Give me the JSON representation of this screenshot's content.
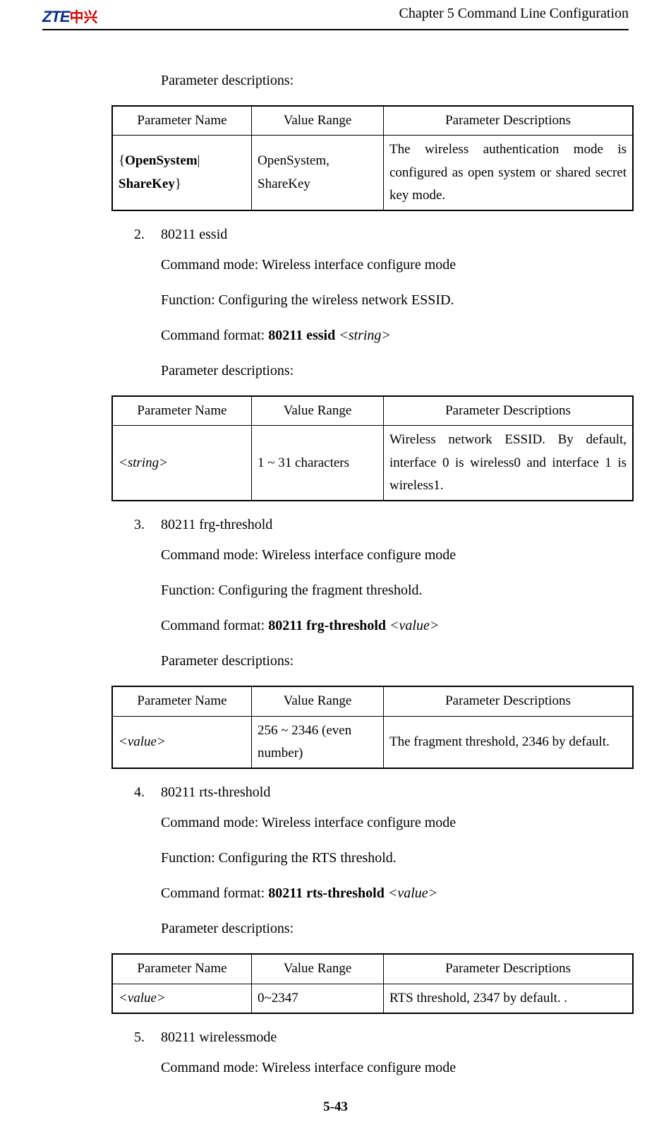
{
  "header": {
    "logo_en": "ZTE",
    "logo_cn": "中兴",
    "chapter": "Chapter 5 Command Line Configuration"
  },
  "intro_para": "Parameter descriptions:",
  "table_headers": {
    "name": "Parameter Name",
    "range": "Value Range",
    "desc": "Parameter Descriptions"
  },
  "table1": {
    "name_prefix": "{",
    "name_bold1": "OpenSystem",
    "name_sep": "| ",
    "name_bold2": "ShareKey",
    "name_suffix": "}",
    "range": "OpenSystem, ShareKey",
    "desc": "The wireless authentication mode is configured as open system or shared secret key mode."
  },
  "sections": [
    {
      "num": "2.",
      "title": "80211 essid",
      "mode_label": "Command mode: ",
      "mode_value": "Wireless interface configure mode",
      "func_label": "Function: ",
      "func_value": "Configuring the wireless network ESSID.",
      "fmt_label": "Command format: ",
      "fmt_bold": "80211 essid ",
      "fmt_italic": "<string>",
      "param_label": "Parameter descriptions:",
      "trow": {
        "name_italic": "<string>",
        "range": "1 ~ 31 characters",
        "desc": "Wireless network ESSID. By default, interface 0 is wireless0 and interface 1 is wireless1."
      }
    },
    {
      "num": "3.",
      "title": "80211 frg-threshold",
      "mode_label": "Command mode: ",
      "mode_value": "Wireless interface configure mode",
      "func_label": "Function: ",
      "func_value": "Configuring the fragment threshold.",
      "fmt_label": "Command format: ",
      "fmt_bold": "80211 frg-threshold ",
      "fmt_italic": "<value>",
      "param_label": "Parameter descriptions:",
      "trow": {
        "name_italic": "<value>",
        "range": "256 ~ 2346 (even number)",
        "desc": "The fragment threshold, 2346 by default."
      }
    },
    {
      "num": "4.",
      "title": "80211 rts-threshold",
      "mode_label": "Command mode: ",
      "mode_value": "Wireless interface configure mode",
      "func_label": "Function: ",
      "func_value": "Configuring the RTS threshold.",
      "fmt_label": "Command format: ",
      "fmt_bold": "80211 rts-threshold ",
      "fmt_italic": "<value>",
      "param_label": "Parameter descriptions:",
      "trow": {
        "name_italic": "<value>",
        "range": "0~2347",
        "desc": "RTS threshold, 2347 by default. ."
      }
    },
    {
      "num": "5.",
      "title": "80211 wirelessmode",
      "mode_label": "Command mode: ",
      "mode_value": "Wireless interface configure mode"
    }
  ],
  "page_number": "5-43"
}
